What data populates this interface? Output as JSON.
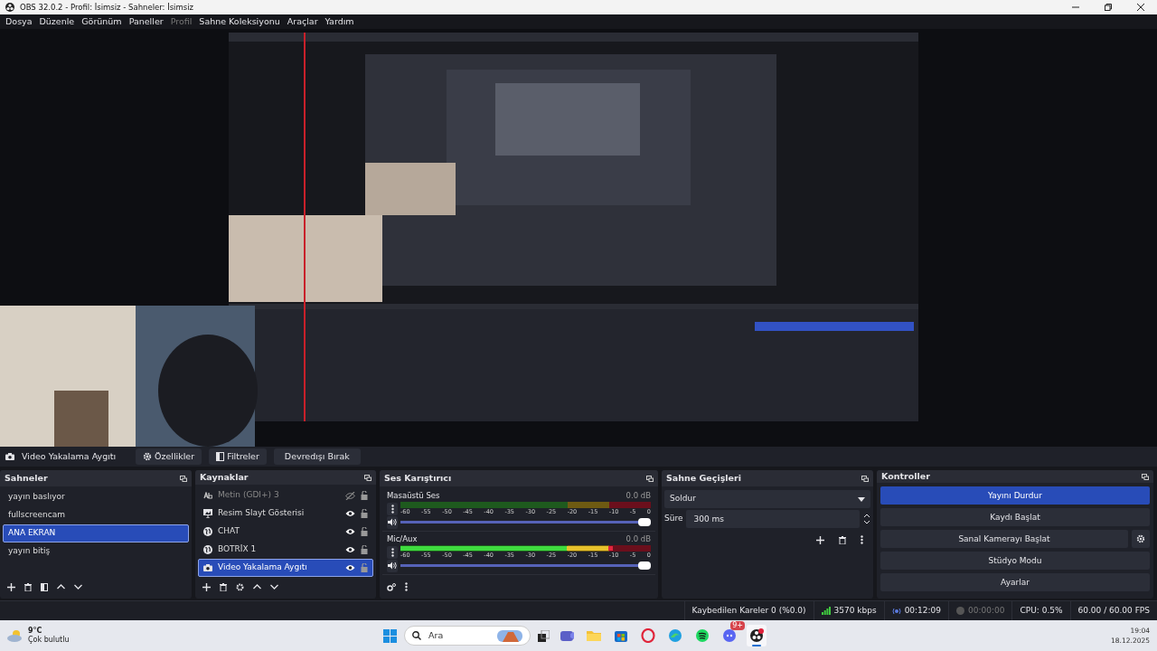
{
  "window": {
    "title": "OBS 32.0.2 - Profil: İsimsiz - Sahneler: İsimsiz"
  },
  "menu": [
    {
      "label": "Dosya",
      "disabled": false
    },
    {
      "label": "Düzenle",
      "disabled": false
    },
    {
      "label": "Görünüm",
      "disabled": false
    },
    {
      "label": "Paneller",
      "disabled": false
    },
    {
      "label": "Profil",
      "disabled": true
    },
    {
      "label": "Sahne Koleksiyonu",
      "disabled": false
    },
    {
      "label": "Araçlar",
      "disabled": false
    },
    {
      "label": "Yardım",
      "disabled": false
    }
  ],
  "source_toolbar": {
    "source": "Video Yakalama Aygıtı",
    "buttons": [
      {
        "label": "Özellikler",
        "kind": "gear"
      },
      {
        "label": "Filtreler",
        "kind": "filter"
      },
      {
        "label": "Devredışı Bırak",
        "kind": "plain"
      }
    ]
  },
  "scenes": {
    "title": "Sahneler",
    "items": [
      {
        "label": "yayın baslıyor",
        "selected": false
      },
      {
        "label": "fullscreencam",
        "selected": false
      },
      {
        "label": "ANA EKRAN",
        "selected": true
      },
      {
        "label": "yayın bitiş",
        "selected": false
      }
    ]
  },
  "sources": {
    "title": "Kaynaklar",
    "items": [
      {
        "label": "Metin (GDI+) 3",
        "kind": "text",
        "visible": false,
        "selected": false
      },
      {
        "label": "Resim Slayt Gösterisi",
        "kind": "slideshow",
        "visible": true,
        "selected": false
      },
      {
        "label": "CHAT",
        "kind": "browser",
        "visible": true,
        "selected": false
      },
      {
        "label": "BOTRİX 1",
        "kind": "browser",
        "visible": true,
        "selected": false
      },
      {
        "label": "Video Yakalama Aygıtı",
        "kind": "camera",
        "visible": true,
        "selected": true
      }
    ]
  },
  "mixer": {
    "title": "Ses Karıştırıcı",
    "channels": [
      {
        "name": "Masaüstü Ses",
        "reading": "0.0 dB",
        "level": 0.0,
        "volume": {
          "level": 1.0
        },
        "ticks": [
          "-60",
          "-55",
          "-50",
          "-45",
          "-40",
          "-35",
          "-30",
          "-25",
          "-20",
          "-15",
          "-10",
          "-5",
          "0"
        ]
      },
      {
        "name": "Mic/Aux",
        "reading": "0.0 dB",
        "level": 0.85,
        "volume": {
          "level": 1.0
        },
        "ticks": [
          "-60",
          "-55",
          "-50",
          "-45",
          "-40",
          "-35",
          "-30",
          "-25",
          "-20",
          "-15",
          "-10",
          "-5",
          "0"
        ]
      }
    ]
  },
  "transitions": {
    "title": "Sahne Geçişleri",
    "transition": "Soldur",
    "duration_label": "Süre",
    "duration": "300 ms"
  },
  "controls": {
    "title": "Kontroller",
    "buttons": [
      {
        "label": "Yayını Durdur",
        "active": true,
        "settings": false
      },
      {
        "label": "Kaydı Başlat",
        "active": false,
        "settings": false
      },
      {
        "label": "Sanal Kamerayı Başlat",
        "active": false,
        "settings": true
      },
      {
        "label": "Stüdyo Modu",
        "active": false,
        "settings": false
      },
      {
        "label": "Ayarlar",
        "active": false,
        "settings": false
      }
    ]
  },
  "status_bar": {
    "dropped_frames": "Kaybedilen Kareler 0 (%0.0)",
    "bitrate": "3570 kbps",
    "stream_time": "00:12:09",
    "record_time": "00:00:00",
    "recording": false,
    "cpu": "CPU: 0.5%",
    "fps": "60.00 / 60.00 FPS"
  },
  "taskbar": {
    "temperature": "9°C",
    "weather": "Çok bulutlu",
    "search": {
      "placeholder": "Ara"
    },
    "apps": [
      {
        "kind": "meet",
        "active": false
      },
      {
        "kind": "folder",
        "active": false
      },
      {
        "kind": "store",
        "active": false
      },
      {
        "kind": "opera",
        "active": false
      },
      {
        "kind": "edge",
        "active": false
      },
      {
        "kind": "spotify",
        "active": false
      },
      {
        "kind": "discord",
        "active": false,
        "badge": "9+"
      },
      {
        "kind": "obs",
        "active": true
      }
    ],
    "time": "19:04",
    "date": "18.12.2025"
  }
}
